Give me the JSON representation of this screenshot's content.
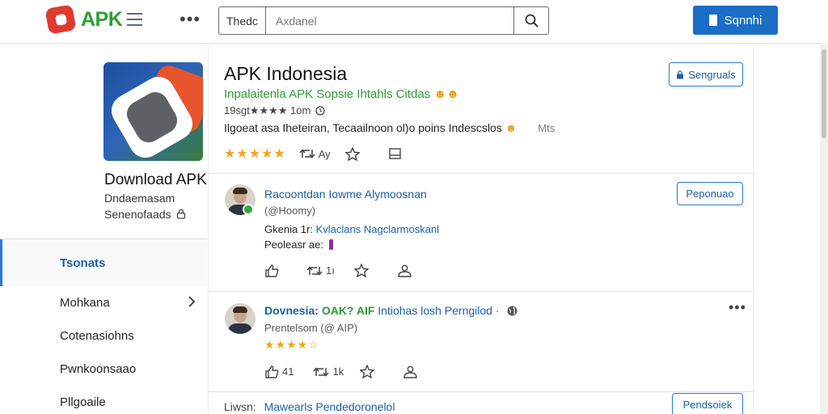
{
  "header": {
    "logo_text": "APK",
    "search_scope": "Thedc",
    "search_placeholder": "Axdanel",
    "signin_label": "Sqnnhi"
  },
  "sidebar": {
    "app_card": {
      "title": "Download APK",
      "subtitle_1": "Dndaemasam",
      "subtitle_2": "Senenofaads"
    },
    "nav_items": [
      {
        "label": "Tsonats",
        "active": true
      },
      {
        "label": "Mohkana",
        "has_chevron": true
      },
      {
        "label": "Cotenasiohns"
      },
      {
        "label": "Pwnkoonsaao"
      },
      {
        "label": "Pllgoaile"
      }
    ]
  },
  "app": {
    "title": "APK Indonesia",
    "tagline": "Inpalaitenla APK  Sopsie Ihtahls Citdas",
    "meta": "19sgt★★★★  1om",
    "description": "Ilgoeat asa  Iheteiran, Tecaailnoon ol)o poins Indescslos",
    "more_link": "Mts",
    "follow_label": "Sengruals",
    "rating_stars": "★★★★★",
    "retweet_count": "Ay"
  },
  "posts": [
    {
      "name": "Racoontdan Iowme Alymoosnan",
      "handle": "(@Hoomy)",
      "body_prefix": "Gkenia  1r:",
      "body_link": "Kvlaclans Nagclarmoskanl",
      "body_line2": "Peoleasr ae:",
      "follow_label": "Peponuao",
      "retweet_count": "1ı"
    },
    {
      "name_prefix": "Dovnesia:",
      "name_green": "OAK? AIF",
      "name_rest": "Intiohas losh Perngilod",
      "handle": "Prentelsom (@ AIP)",
      "rating_stars": "★★★★☆",
      "like_count": "41",
      "retweet_count": "1k"
    },
    {
      "prefix": "Liwsn:",
      "title": "Mawearls Pendedoronelol",
      "follow_label": "Pendsoiek"
    }
  ],
  "colors": {
    "brand_green": "#2f9e33",
    "logo_red": "#e03a2f",
    "primary_blue": "#1a6ec5",
    "link_blue": "#1a5fa8",
    "star_gold": "#f0a51e"
  }
}
